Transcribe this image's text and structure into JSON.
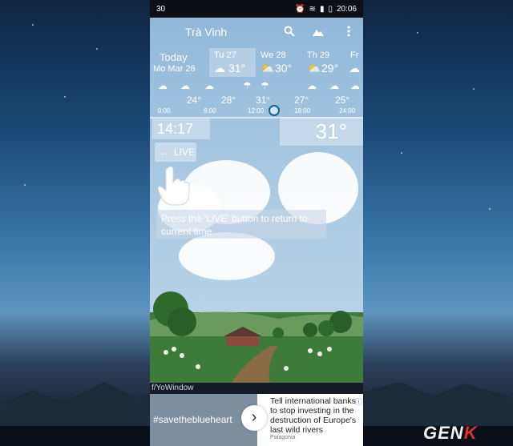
{
  "status_bar": {
    "left": "30",
    "time": "20:06"
  },
  "toolbar": {
    "city": "Trà Vinh",
    "icons": [
      "search-icon",
      "landscape-icon",
      "more-vertical-icon"
    ]
  },
  "days": [
    {
      "name": "Today",
      "date": "Mo Mar 26"
    },
    {
      "name": "Tu 27",
      "temp": "31°",
      "icon": "partly-cloudy-icon"
    },
    {
      "name": "We 28",
      "temp": "30°",
      "icon": "partly-cloudy-icon"
    },
    {
      "name": "Th 29",
      "temp": "29°",
      "icon": "sun-cloud-icon"
    },
    {
      "name": "Fr",
      "icon": "rain-cloud-icon"
    }
  ],
  "hourly": {
    "temps": [
      "24°",
      "28°",
      "31°",
      "27°",
      "25°"
    ],
    "times": [
      "0:00",
      "6:00",
      "12:00",
      "18:00",
      "24:00"
    ]
  },
  "current": {
    "time": "14:17",
    "temp": "31°"
  },
  "live_button": {
    "label": "LIVE"
  },
  "tooltip": {
    "text": "Press the 'LIVE' button to return to current time"
  },
  "footer_brand": "f/YoWindow",
  "ad": {
    "left_text": "#savetheblueheart",
    "headline": "Tell international banks to stop investing in the destruction of Europe's last wild rivers",
    "sponsor": "Patagonia"
  },
  "watermark": {
    "text": "GEN",
    "accent": "K"
  },
  "colors": {
    "accent_marker": "#1d5e8e",
    "watermark_accent": "#e03030"
  }
}
